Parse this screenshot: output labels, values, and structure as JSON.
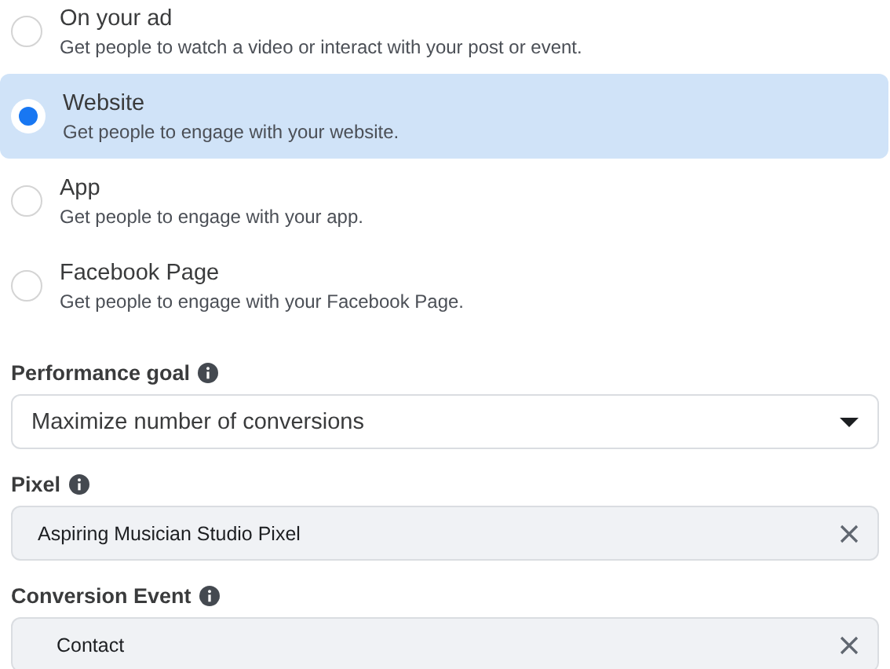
{
  "destination_options": [
    {
      "title": "On your ad",
      "description": "Get people to watch a video or interact with your post or event.",
      "selected": false
    },
    {
      "title": "Website",
      "description": "Get people to engage with your website.",
      "selected": true
    },
    {
      "title": "App",
      "description": "Get people to engage with your app.",
      "selected": false
    },
    {
      "title": "Facebook Page",
      "description": "Get people to engage with your Facebook Page.",
      "selected": false
    }
  ],
  "fields": [
    {
      "label": "Performance goal",
      "kind": "dropdown",
      "value": "Maximize number of conversions"
    },
    {
      "label": "Pixel",
      "kind": "selected",
      "value": "Aspiring Musician Studio Pixel"
    },
    {
      "label": "Conversion Event",
      "kind": "selected",
      "value": "Contact"
    }
  ]
}
